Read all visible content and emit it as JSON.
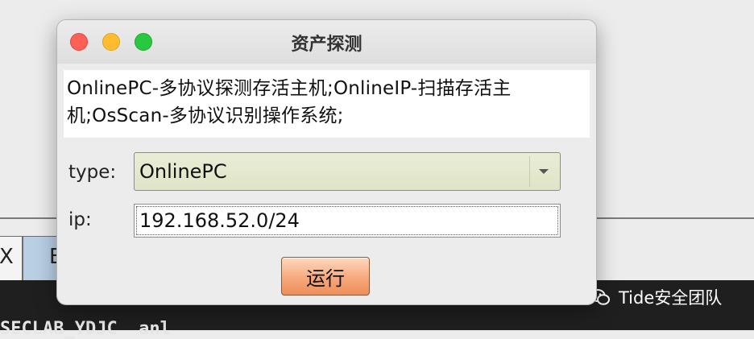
{
  "background": {
    "tab1_label": "X",
    "tab2_label": "E",
    "bottom_text": "SECLAB_YDJC  anl"
  },
  "watermark": {
    "text": "Tide安全团队",
    "icon": "wechat-icon"
  },
  "dialog": {
    "title": "资产探测",
    "description": "OnlinePC-多协议探测存活主机;OnlineIP-扫描存活主机;OsScan-多协议识别操作系统;",
    "type_label": "type:",
    "type_selected": "OnlinePC",
    "ip_label": "ip:",
    "ip_value": "192.168.52.0/24",
    "run_label": "运行",
    "controls": {
      "close_icon": "close-icon",
      "minimize_icon": "minimize-icon",
      "maximize_icon": "maximize-icon",
      "dropdown_icon": "chevron-down-icon"
    }
  },
  "colors": {
    "close": "#fe5f57",
    "minimize": "#febc2e",
    "maximize": "#28c840",
    "run_button": "#f6a97d",
    "select_bg": "#e3e7cc"
  }
}
